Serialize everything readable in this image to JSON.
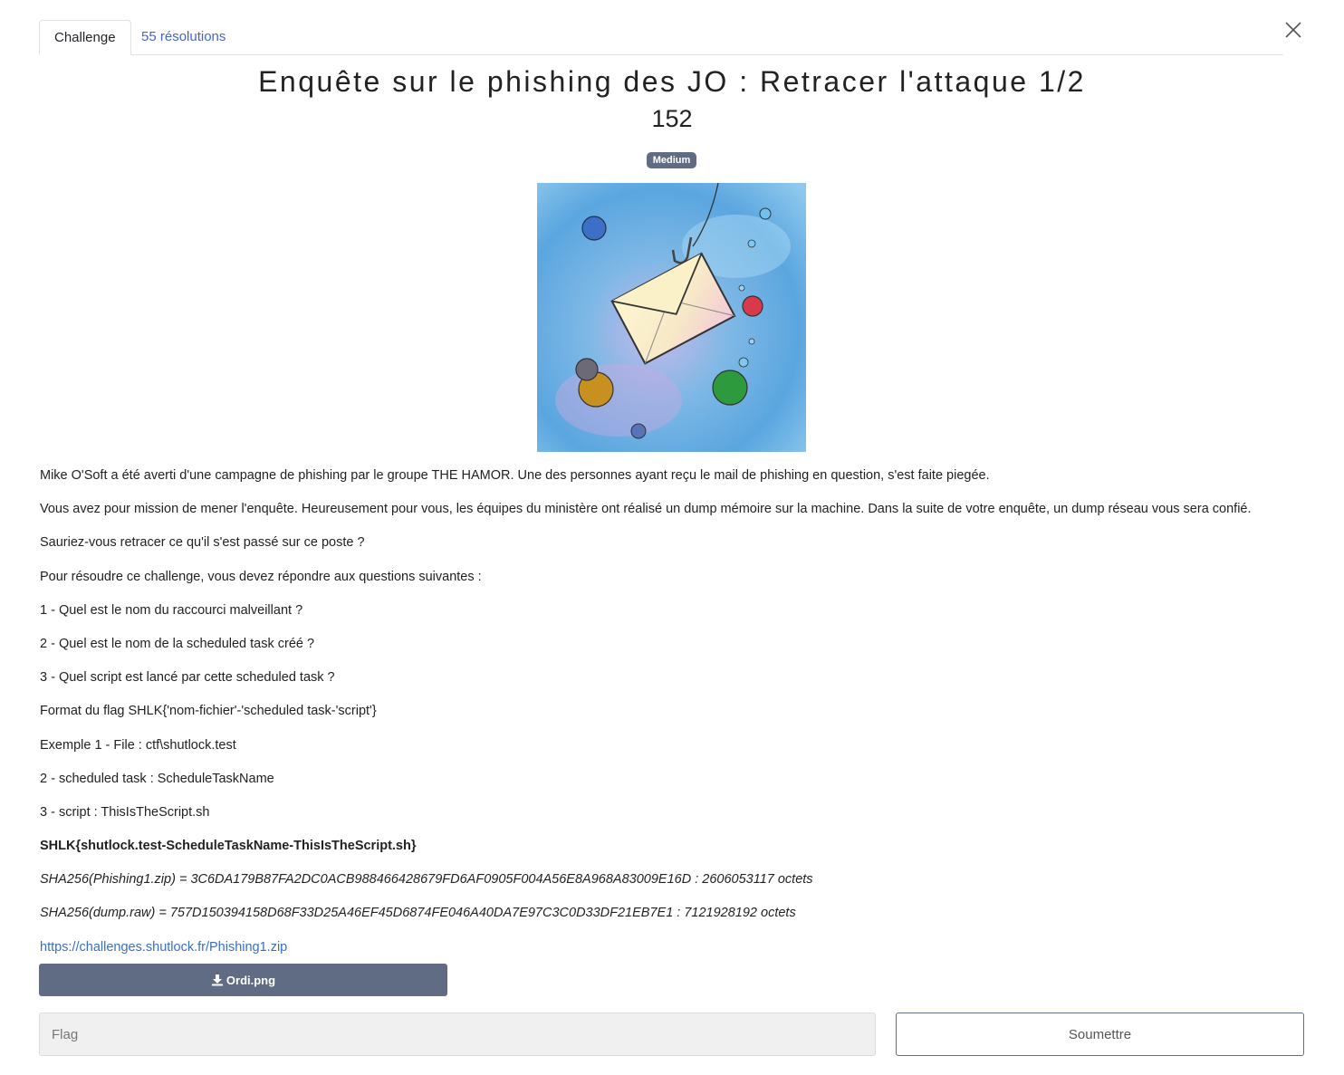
{
  "tabs": {
    "challenge_label": "Challenge",
    "solves_label": "55 résolutions"
  },
  "challenge": {
    "title": "Enquête sur le phishing des JO : Retracer l'attaque 1/2",
    "points": "152",
    "difficulty": "Medium",
    "illustration": "watercolor envelope on fishing hook with bubbles"
  },
  "description": {
    "p1": "Mike O'Soft a été averti d'une campagne de phishing par le groupe THE HAMOR. Une des personnes ayant reçu le mail de phishing en question, s'est faite piegée.",
    "p2": "Vous avez pour mission de mener l'enquête. Heureusement pour vous, les équipes du ministère ont réalisé un dump mémoire sur la machine. Dans la suite de votre enquête, un dump réseau vous sera confié.",
    "p3": "Sauriez-vous retracer ce qu'il s'est passé sur ce poste ?",
    "p4": "Pour résoudre ce challenge, vous devez répondre aux questions suivantes :",
    "q1": "1 - Quel est le nom du raccourci malveillant ?",
    "q2": "2 - Quel est le nom de la scheduled task créé ?",
    "q3": "3 - Quel script est lancé par cette scheduled task ?",
    "format": "Format du flag SHLK{'nom-fichier'-'scheduled task-'script'}",
    "ex1": "Exemple 1 - File : ctf\\shutlock.test",
    "ex2": "2 - scheduled task : ScheduleTaskName",
    "ex3": "3 - script : ThisIsTheScript.sh",
    "example_flag": "SHLK{shutlock.test-ScheduleTaskName-ThisIsTheScript.sh}",
    "hash1": "SHA256(Phishing1.zip) = 3C6DA179B87FA2DC0ACB988466428679FD6AF0905F004A56E8A968A83009E16D : 2606053117 octets",
    "hash2": "SHA256(dump.raw) = 757D150394158D68F33D25A46EF45D6874FE046A40DA7E97C3C0D33DF21EB7E1 : 7121928192 octets",
    "link": "https://challenges.shutlock.fr/Phishing1.zip"
  },
  "download": {
    "label": "Ordi.png",
    "icon": "download-icon"
  },
  "flag_form": {
    "placeholder": "Flag",
    "value": "",
    "submit_label": "Soumettre"
  },
  "colors": {
    "accent": "#5f6c84",
    "link": "#4466cc"
  }
}
